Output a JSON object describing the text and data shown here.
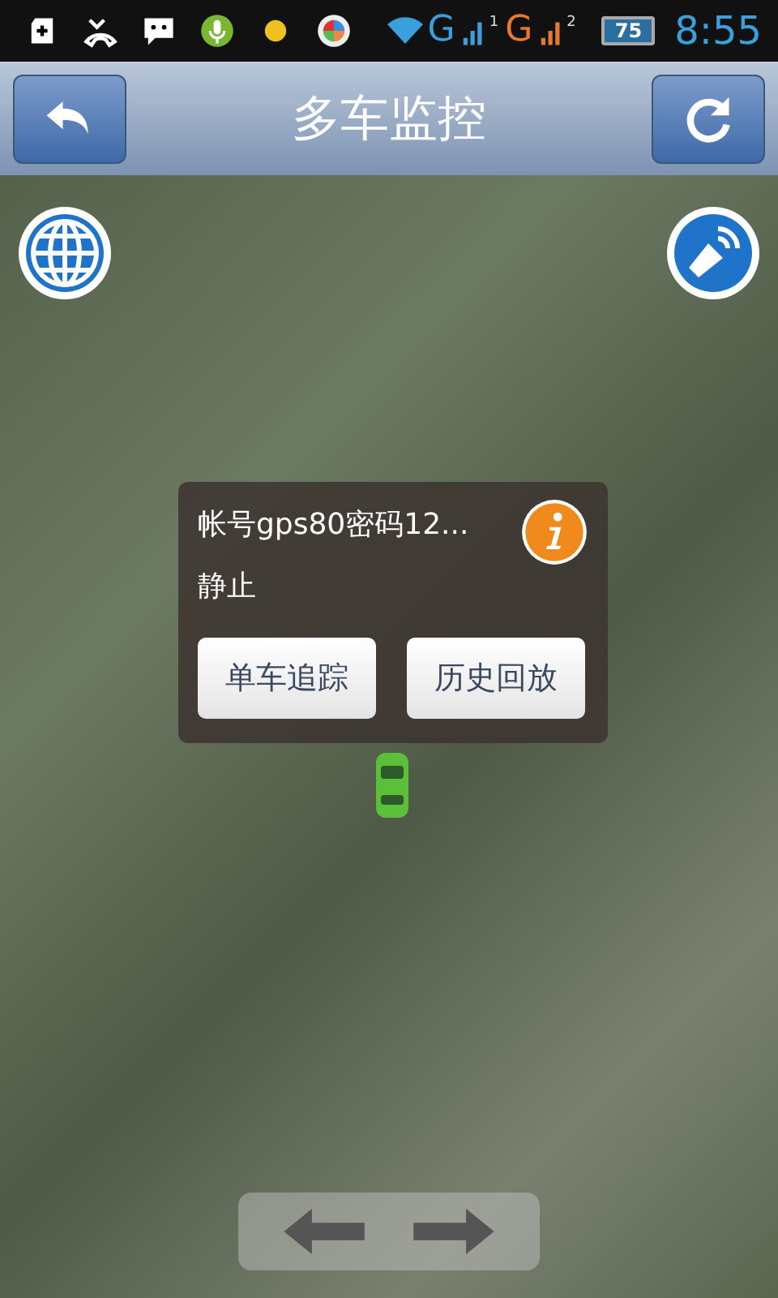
{
  "status_bar": {
    "network_1": "G",
    "sim_1": "1",
    "network_2": "G",
    "sim_2": "2",
    "battery": "75",
    "time": "8:55"
  },
  "title_bar": {
    "title": "多车监控"
  },
  "popup": {
    "account": "帐号gps80密码12...",
    "state": "静止",
    "buttons": [
      {
        "label": "单车追踪"
      },
      {
        "label": "历史回放"
      }
    ]
  }
}
